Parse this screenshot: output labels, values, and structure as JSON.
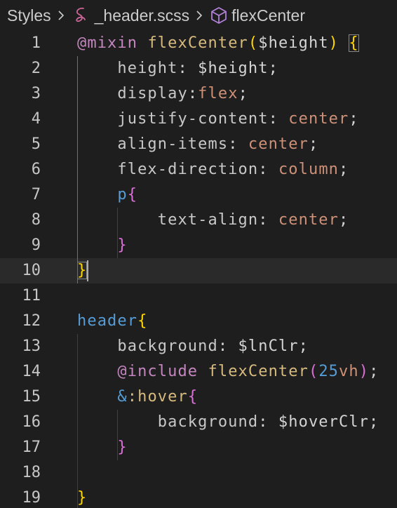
{
  "breadcrumb": {
    "folder": "Styles",
    "file": "_header.scss",
    "symbol": "flexCenter",
    "file_icon": "sass-icon",
    "symbol_icon": "cube-icon",
    "separator_icon": "chevron-right-icon"
  },
  "colors": {
    "background": "#1e1e1e",
    "current_line": "#2a2a2a",
    "line_number": "#c6c6c6",
    "keyword": "#c586c0",
    "function": "#dcdcaa",
    "property": "#9cdcfe",
    "value": "#ce9178",
    "tag": "#569cd6",
    "number": "#b5cea8",
    "bracket": "#ffd700"
  },
  "editor": {
    "current_line": 10,
    "lines": [
      {
        "n": "1",
        "tokens": [
          [
            "@mixin",
            "t-kw"
          ],
          [
            " ",
            ""
          ],
          [
            "flexCenter",
            "t-fn2"
          ],
          [
            "(",
            "t-br1"
          ],
          [
            "$height",
            "t-var2"
          ],
          [
            ")",
            "t-br1"
          ],
          [
            " ",
            ""
          ],
          [
            "{",
            "t-br1 bracket-box"
          ]
        ]
      },
      {
        "n": "2",
        "tokens": [
          [
            "    ",
            ""
          ],
          [
            "height",
            "t-prop2"
          ],
          [
            ": ",
            "t-pun"
          ],
          [
            "$height",
            "t-var2"
          ],
          [
            ";",
            "t-pun"
          ]
        ]
      },
      {
        "n": "3",
        "tokens": [
          [
            "    ",
            ""
          ],
          [
            "display",
            "t-prop2"
          ],
          [
            ":",
            "t-pun"
          ],
          [
            "flex",
            "t-val"
          ],
          [
            ";",
            "t-pun"
          ]
        ]
      },
      {
        "n": "4",
        "tokens": [
          [
            "    ",
            ""
          ],
          [
            "justify-content",
            "t-prop2"
          ],
          [
            ": ",
            "t-pun"
          ],
          [
            "center",
            "t-val"
          ],
          [
            ";",
            "t-pun"
          ]
        ]
      },
      {
        "n": "5",
        "tokens": [
          [
            "    ",
            ""
          ],
          [
            "align-items",
            "t-prop2"
          ],
          [
            ": ",
            "t-pun"
          ],
          [
            "center",
            "t-val"
          ],
          [
            ";",
            "t-pun"
          ]
        ]
      },
      {
        "n": "6",
        "tokens": [
          [
            "    ",
            ""
          ],
          [
            "flex-direction",
            "t-prop2"
          ],
          [
            ": ",
            "t-pun"
          ],
          [
            "column",
            "t-val"
          ],
          [
            ";",
            "t-pun"
          ]
        ]
      },
      {
        "n": "7",
        "tokens": [
          [
            "    ",
            ""
          ],
          [
            "p",
            "t-tag"
          ],
          [
            "{",
            "t-br2"
          ]
        ]
      },
      {
        "n": "8",
        "tokens": [
          [
            "        ",
            ""
          ],
          [
            "text-align",
            "t-prop2"
          ],
          [
            ": ",
            "t-pun"
          ],
          [
            "center",
            "t-val"
          ],
          [
            ";",
            "t-pun"
          ]
        ]
      },
      {
        "n": "9",
        "tokens": [
          [
            "    ",
            ""
          ],
          [
            "}",
            "t-br2"
          ]
        ]
      },
      {
        "n": "10",
        "tokens": [
          [
            "}",
            "t-br1 bracket-box"
          ]
        ]
      },
      {
        "n": "11",
        "tokens": []
      },
      {
        "n": "12",
        "tokens": [
          [
            "header",
            "t-tag"
          ],
          [
            "{",
            "t-br1"
          ]
        ]
      },
      {
        "n": "13",
        "tokens": [
          [
            "    ",
            ""
          ],
          [
            "background",
            "t-prop2"
          ],
          [
            ": ",
            "t-pun"
          ],
          [
            "$lnClr",
            "t-var2"
          ],
          [
            ";",
            "t-pun"
          ]
        ]
      },
      {
        "n": "14",
        "tokens": [
          [
            "    ",
            ""
          ],
          [
            "@include",
            "t-kw"
          ],
          [
            " ",
            ""
          ],
          [
            "flexCenter",
            "t-fn2"
          ],
          [
            "(",
            "t-br2"
          ],
          [
            "25",
            "t-tag"
          ],
          [
            "vh",
            "t-val"
          ],
          [
            ")",
            "t-br2"
          ],
          [
            ";",
            "t-pun"
          ]
        ]
      },
      {
        "n": "15",
        "tokens": [
          [
            "    ",
            ""
          ],
          [
            "&",
            "t-tag"
          ],
          [
            ":hover",
            "t-fn2"
          ],
          [
            "{",
            "t-br2"
          ]
        ]
      },
      {
        "n": "16",
        "tokens": [
          [
            "        ",
            ""
          ],
          [
            "background",
            "t-prop2"
          ],
          [
            ": ",
            "t-pun"
          ],
          [
            "$hoverClr",
            "t-var2"
          ],
          [
            ";",
            "t-pun"
          ]
        ]
      },
      {
        "n": "17",
        "tokens": [
          [
            "    ",
            ""
          ],
          [
            "}",
            "t-br2"
          ]
        ]
      },
      {
        "n": "18",
        "tokens": []
      },
      {
        "n": "19",
        "tokens": [
          [
            "}",
            "t-br1"
          ]
        ]
      }
    ]
  }
}
